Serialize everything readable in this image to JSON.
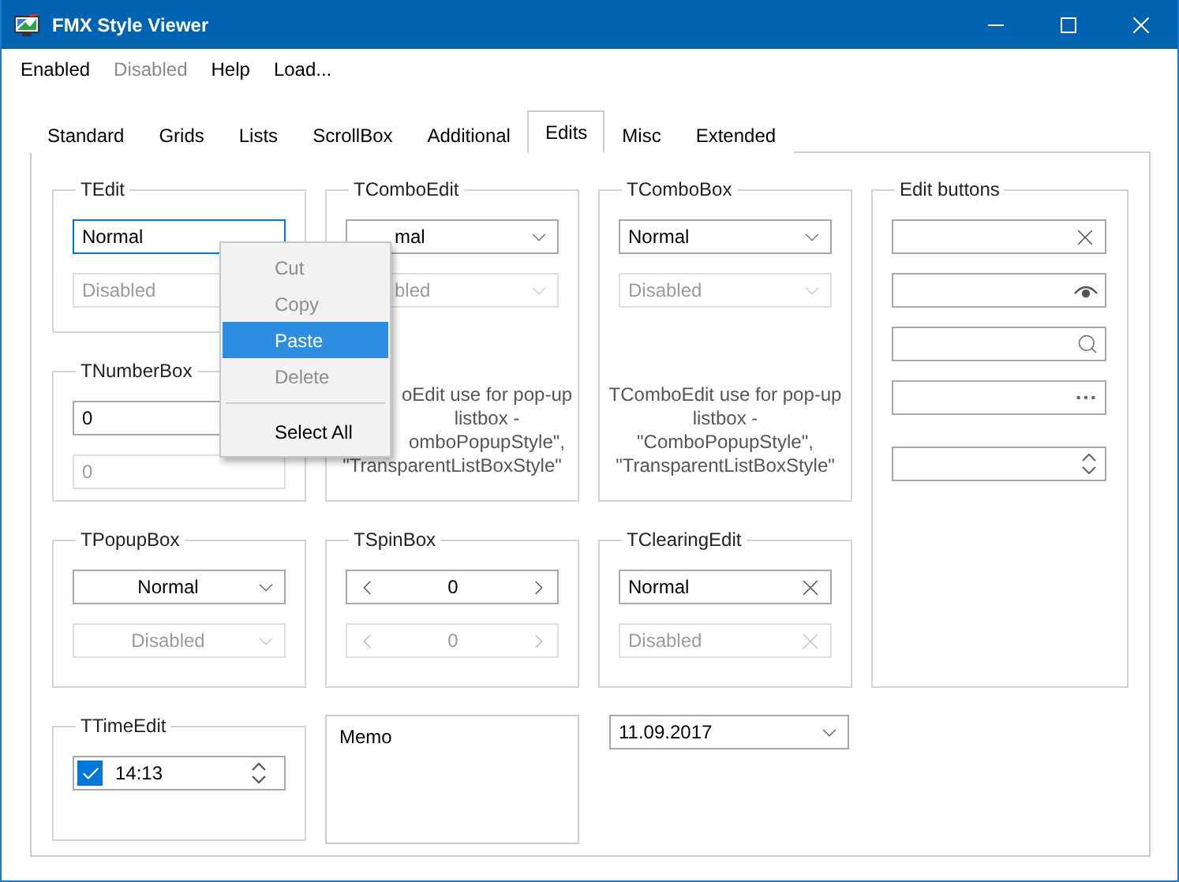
{
  "window": {
    "title": "FMX Style Viewer"
  },
  "menu": [
    {
      "label": "Enabled",
      "disabled": false
    },
    {
      "label": "Disabled",
      "disabled": true
    },
    {
      "label": "Help",
      "disabled": false
    },
    {
      "label": "Load...",
      "disabled": false
    }
  ],
  "tabs": [
    {
      "label": "Standard",
      "selected": false
    },
    {
      "label": "Grids",
      "selected": false
    },
    {
      "label": "Lists",
      "selected": false
    },
    {
      "label": "ScrollBox",
      "selected": false
    },
    {
      "label": "Additional",
      "selected": false
    },
    {
      "label": "Edits",
      "selected": true
    },
    {
      "label": "Misc",
      "selected": false
    },
    {
      "label": "Extended",
      "selected": false
    }
  ],
  "groups": [
    {
      "title": "TEdit",
      "fields": [
        {
          "kind": "edit",
          "value": "Normal",
          "disabled": false,
          "focused": true
        },
        {
          "kind": "edit",
          "value": "Disabled",
          "disabled": true,
          "focused": false
        }
      ]
    },
    {
      "title": "TComboEdit",
      "fields": [
        {
          "kind": "combo",
          "value": "mal",
          "disabled": false
        },
        {
          "kind": "combo",
          "value": "bled",
          "disabled": true
        }
      ],
      "note": {
        "partial_lines": [
          "oEdit use for pop-up",
          "listbox -",
          "omboPopupStyle\","
        ],
        "lines": [
          "\"TransparentListBoxStyle\""
        ]
      }
    },
    {
      "title": "TComboBox",
      "fields": [
        {
          "kind": "combo",
          "value": "Normal",
          "disabled": false
        },
        {
          "kind": "combo",
          "value": "Disabled",
          "disabled": true
        }
      ],
      "note": {
        "lines": [
          "TComboEdit use for pop-up",
          "listbox -",
          "\"ComboPopupStyle\",",
          "\"TransparentListBoxStyle\""
        ]
      }
    },
    {
      "title": "Edit buttons",
      "fields": [
        {
          "kind": "clear",
          "disabled": false
        },
        {
          "kind": "eye",
          "disabled": false
        },
        {
          "kind": "search",
          "disabled": false
        },
        {
          "kind": "ellipsis",
          "disabled": false
        },
        {
          "kind": "updown",
          "disabled": false
        }
      ]
    },
    {
      "title": "TNumberBox",
      "fields": [
        {
          "kind": "edit",
          "value": "0",
          "disabled": false
        },
        {
          "kind": "edit",
          "value": "0",
          "disabled": true
        }
      ]
    },
    {
      "title": "TPopupBox",
      "fields": [
        {
          "kind": "popup",
          "value": "Normal",
          "disabled": false
        },
        {
          "kind": "popup",
          "value": "Disabled",
          "disabled": true
        }
      ]
    },
    {
      "title": "TSpinBox",
      "fields": [
        {
          "kind": "spin",
          "value": "0",
          "disabled": false
        },
        {
          "kind": "spin",
          "value": "0",
          "disabled": true
        }
      ]
    },
    {
      "title": "TClearingEdit",
      "fields": [
        {
          "kind": "clearing",
          "value": "Normal",
          "disabled": false
        },
        {
          "kind": "clearing",
          "value": "Disabled",
          "disabled": true
        }
      ]
    },
    {
      "title": "TTimeEdit",
      "fields": [
        {
          "kind": "time",
          "value": "14:13",
          "checked": true,
          "disabled": false
        }
      ]
    }
  ],
  "memo": {
    "text": "Memo"
  },
  "date_field": {
    "value": "11.09.2017"
  },
  "context_menu": {
    "items": [
      {
        "kind": "item",
        "label": "Cut",
        "disabled": true,
        "selected": false
      },
      {
        "kind": "item",
        "label": "Copy",
        "disabled": true,
        "selected": false
      },
      {
        "kind": "item",
        "label": "Paste",
        "disabled": false,
        "selected": true
      },
      {
        "kind": "item",
        "label": "Delete",
        "disabled": true,
        "selected": false
      },
      {
        "kind": "separator"
      },
      {
        "kind": "item",
        "label": "Select All",
        "disabled": false,
        "selected": false
      }
    ]
  }
}
